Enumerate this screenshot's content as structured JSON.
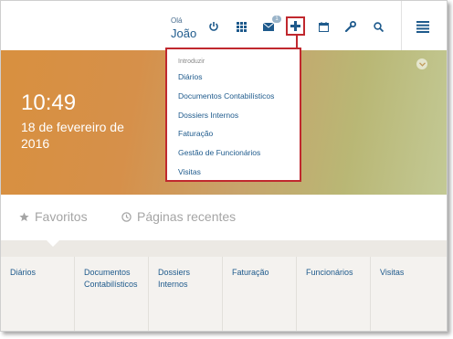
{
  "user": {
    "greeting": "Olá",
    "name": "João"
  },
  "toolbar": {
    "icons": [
      "power-icon",
      "grid-icon",
      "mail-icon",
      "plus-icon",
      "calendar-icon",
      "wrench-icon",
      "search-icon",
      "menu-icon"
    ],
    "mail_badge": "1"
  },
  "hero": {
    "time": "10:49",
    "date": "18 de fevereiro de 2016"
  },
  "dropdown": {
    "header": "Introduzir",
    "items": [
      "Diários",
      "Documentos Contabilísticos",
      "Dossiers Internos",
      "Faturação",
      "Gestão de Funcionários",
      "Visitas"
    ]
  },
  "tabs": {
    "favorites": "Favoritos",
    "recent": "Páginas recentes"
  },
  "shortcuts": [
    "Diários",
    "Documentos Contabilísticos",
    "Dossiers Internos",
    "Faturação",
    "Funcionários",
    "Visitas"
  ],
  "colors": {
    "accent": "#1e5a8c",
    "highlight": "#c0282e",
    "hero_start": "#d8903f",
    "hero_end": "#c3c995"
  }
}
